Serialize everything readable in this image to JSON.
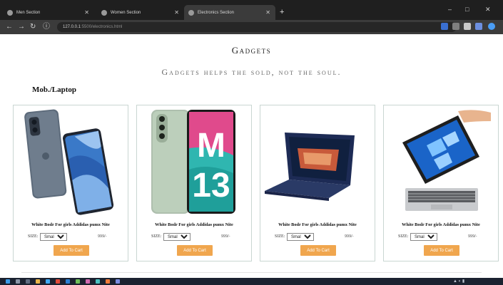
{
  "browser": {
    "tabs": [
      {
        "label": "Men Section"
      },
      {
        "label": "Women Section"
      },
      {
        "label": "Electronics Section"
      }
    ],
    "new_tab": "+",
    "window_controls": {
      "minimize": "–",
      "maximize": "□",
      "close": "✕"
    },
    "address": {
      "host": "127.0.0.1",
      "path": ":5500/electronics.html"
    }
  },
  "page": {
    "title": "Gadgets",
    "tagline": "Gadgets helps the sold, not the soul.",
    "section_heading": "Mob./Laptop",
    "products": [
      {
        "name": "White Bodr For girls Addidas pumx Nite",
        "size_label": "SIZE:",
        "size_value": "Small",
        "price": "999/-",
        "button": "Add To Cart",
        "image": "motorola-phone"
      },
      {
        "name": "White Bodr For girls Addidas pumx Nite",
        "size_label": "SIZE:",
        "size_value": "Small",
        "price": "999/-",
        "button": "Add To Cart",
        "image": "samsung-m13-phone"
      },
      {
        "name": "White Bodr For girls Addidas pumx Nite",
        "size_label": "SIZE:",
        "size_value": "Small",
        "price": "999/-",
        "button": "Add To Cart",
        "image": "convertible-laptop"
      },
      {
        "name": "White Bodr For girls Addidas pumx Nite",
        "size_label": "SIZE:",
        "size_value": "Small",
        "price": "999/-",
        "button": "Add To Cart",
        "image": "detachable-tablet"
      }
    ]
  },
  "colors": {
    "button": "#f0a64e",
    "card_border": "#c9d6d2",
    "chrome_dark": "#1f1f1f"
  }
}
